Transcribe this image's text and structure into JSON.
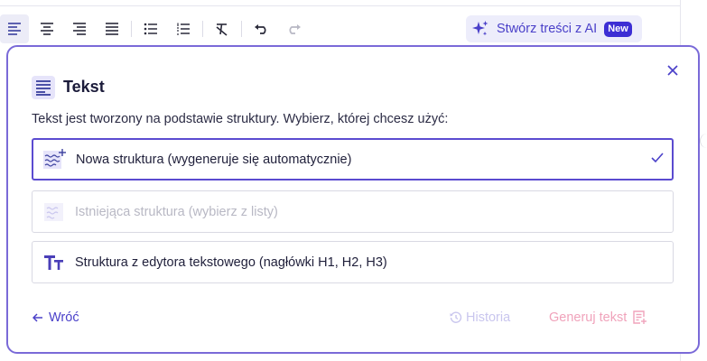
{
  "toolbar": {
    "buttons": [
      {
        "name": "align-left-icon",
        "active": true
      },
      {
        "name": "align-center-icon",
        "active": false
      },
      {
        "name": "align-right-icon",
        "active": false
      },
      {
        "name": "align-justify-icon",
        "active": false
      },
      {
        "name": "bullet-list-icon",
        "active": false
      },
      {
        "name": "numbered-list-icon",
        "active": false
      },
      {
        "name": "clear-format-icon",
        "active": false
      },
      {
        "name": "undo-icon",
        "active": false
      },
      {
        "name": "redo-icon",
        "active": false,
        "disabled": true
      }
    ],
    "ai_button": {
      "label": "Stwórz treści z AI",
      "badge": "New",
      "icon": "sparkles-icon"
    }
  },
  "dialog": {
    "title": "Tekst",
    "title_icon": "text-lines-icon",
    "subtitle": "Tekst jest tworzony na podstawie struktury. Wybierz, której chcesz użyć:",
    "options": [
      {
        "label": "Nowa struktura (wygeneruje się automatycznie)",
        "icon": "new-structure-icon",
        "selected": true,
        "disabled": false
      },
      {
        "label": "Istniejąca struktura (wybierz z listy)",
        "icon": "existing-structure-icon",
        "selected": false,
        "disabled": true
      },
      {
        "label": "Struktura z edytora tekstowego (nagłówki H1, H2, H3)",
        "icon": "text-size-icon",
        "selected": false,
        "disabled": false
      }
    ],
    "back_label": "Wróć",
    "history_label": "Historia",
    "generate_label": "Generuj tekst"
  },
  "colors": {
    "accent": "#4a40c9",
    "panel_border": "#7a6ad8",
    "badge": "#3d2fd4",
    "generate_disabled": "#f0a3bb",
    "history_disabled": "#c9c6ee"
  }
}
